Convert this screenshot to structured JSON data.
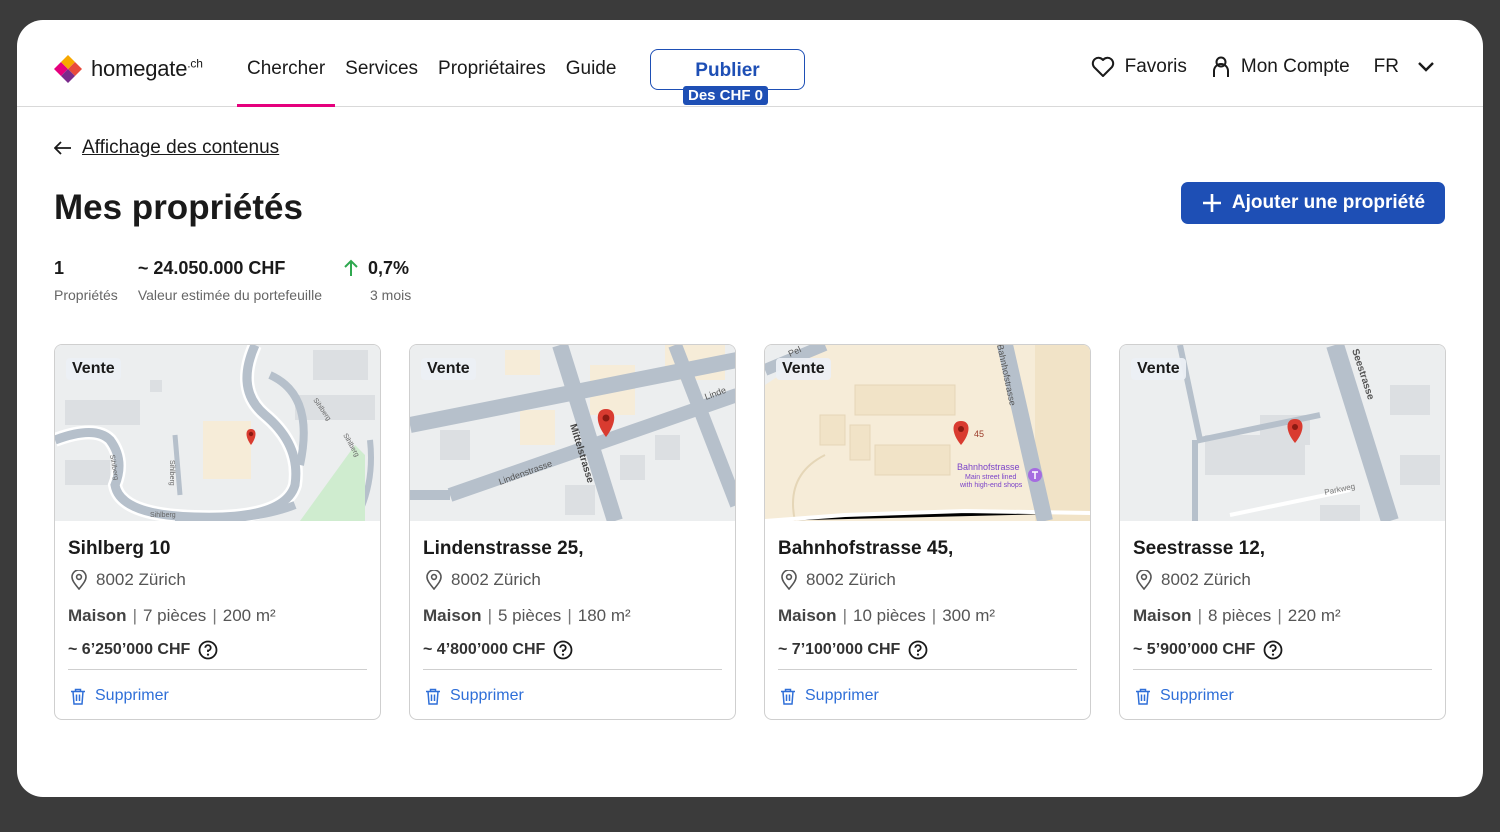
{
  "header": {
    "logo_text": "homegate",
    "logo_suffix": ".ch",
    "nav": [
      "Chercher",
      "Services",
      "Propriétaires",
      "Guide"
    ],
    "publish_label": "Publier",
    "publish_badge": "Des CHF 0",
    "favorites": "Favoris",
    "account": "Mon Compte",
    "language": "FR"
  },
  "back_link": "Affichage des contenus",
  "page_title": "Mes propriétés",
  "add_button": "Ajouter une propriété",
  "stats": [
    {
      "value": "1",
      "label": "Propriétés"
    },
    {
      "value": "~ 24.050.000 CHF",
      "label": "Valeur estimée du portefeuille"
    },
    {
      "value": "0,7%",
      "label": "3 mois"
    }
  ],
  "cards": [
    {
      "tag": "Vente",
      "title": "Sihlberg 10",
      "city": "8002 Zürich",
      "type": "Maison",
      "rooms": "7 pièces",
      "area": "200 m²",
      "price": "~ 6’250’000 CHF",
      "delete": "Supprimer",
      "streets": [
        "Sihlberg",
        "Sihlberg",
        "Sihlberg",
        "Sihlberg",
        "Sihlberg"
      ]
    },
    {
      "tag": "Vente",
      "title": "Lindenstrasse 25,",
      "city": "8002 Zürich",
      "type": "Maison",
      "rooms": "5 pièces",
      "area": "180 m²",
      "price": "~ 4’800’000 CHF",
      "delete": "Supprimer",
      "streets": [
        "Lindenstrasse",
        "Mittelstrasse",
        "Linde"
      ]
    },
    {
      "tag": "Vente",
      "title": "Bahnhofstrasse 45,",
      "city": "8002 Zürich",
      "type": "Maison",
      "rooms": "10 pièces",
      "area": "300 m²",
      "price": "~ 7’100’000 CHF",
      "delete": "Supprimer",
      "streets": [
        "Bahnhofstrasse",
        "Pel",
        "45"
      ],
      "poi": [
        "Bahnhofstrasse",
        "Main street lined",
        "with high-end shops"
      ]
    },
    {
      "tag": "Vente",
      "title": "Seestrasse 12,",
      "city": "8002 Zürich",
      "type": "Maison",
      "rooms": "8 pièces",
      "area": "220 m²",
      "price": "~ 5’900’000 CHF",
      "delete": "Supprimer",
      "streets": [
        "Seestrasse",
        "Parkweg"
      ]
    }
  ],
  "colors": {
    "brand_blue": "#1e4fb5",
    "accent_pink": "#e5007d",
    "trend_green": "#2fa84f",
    "link_blue": "#2f6fd8",
    "pin_red": "#d93b30"
  }
}
